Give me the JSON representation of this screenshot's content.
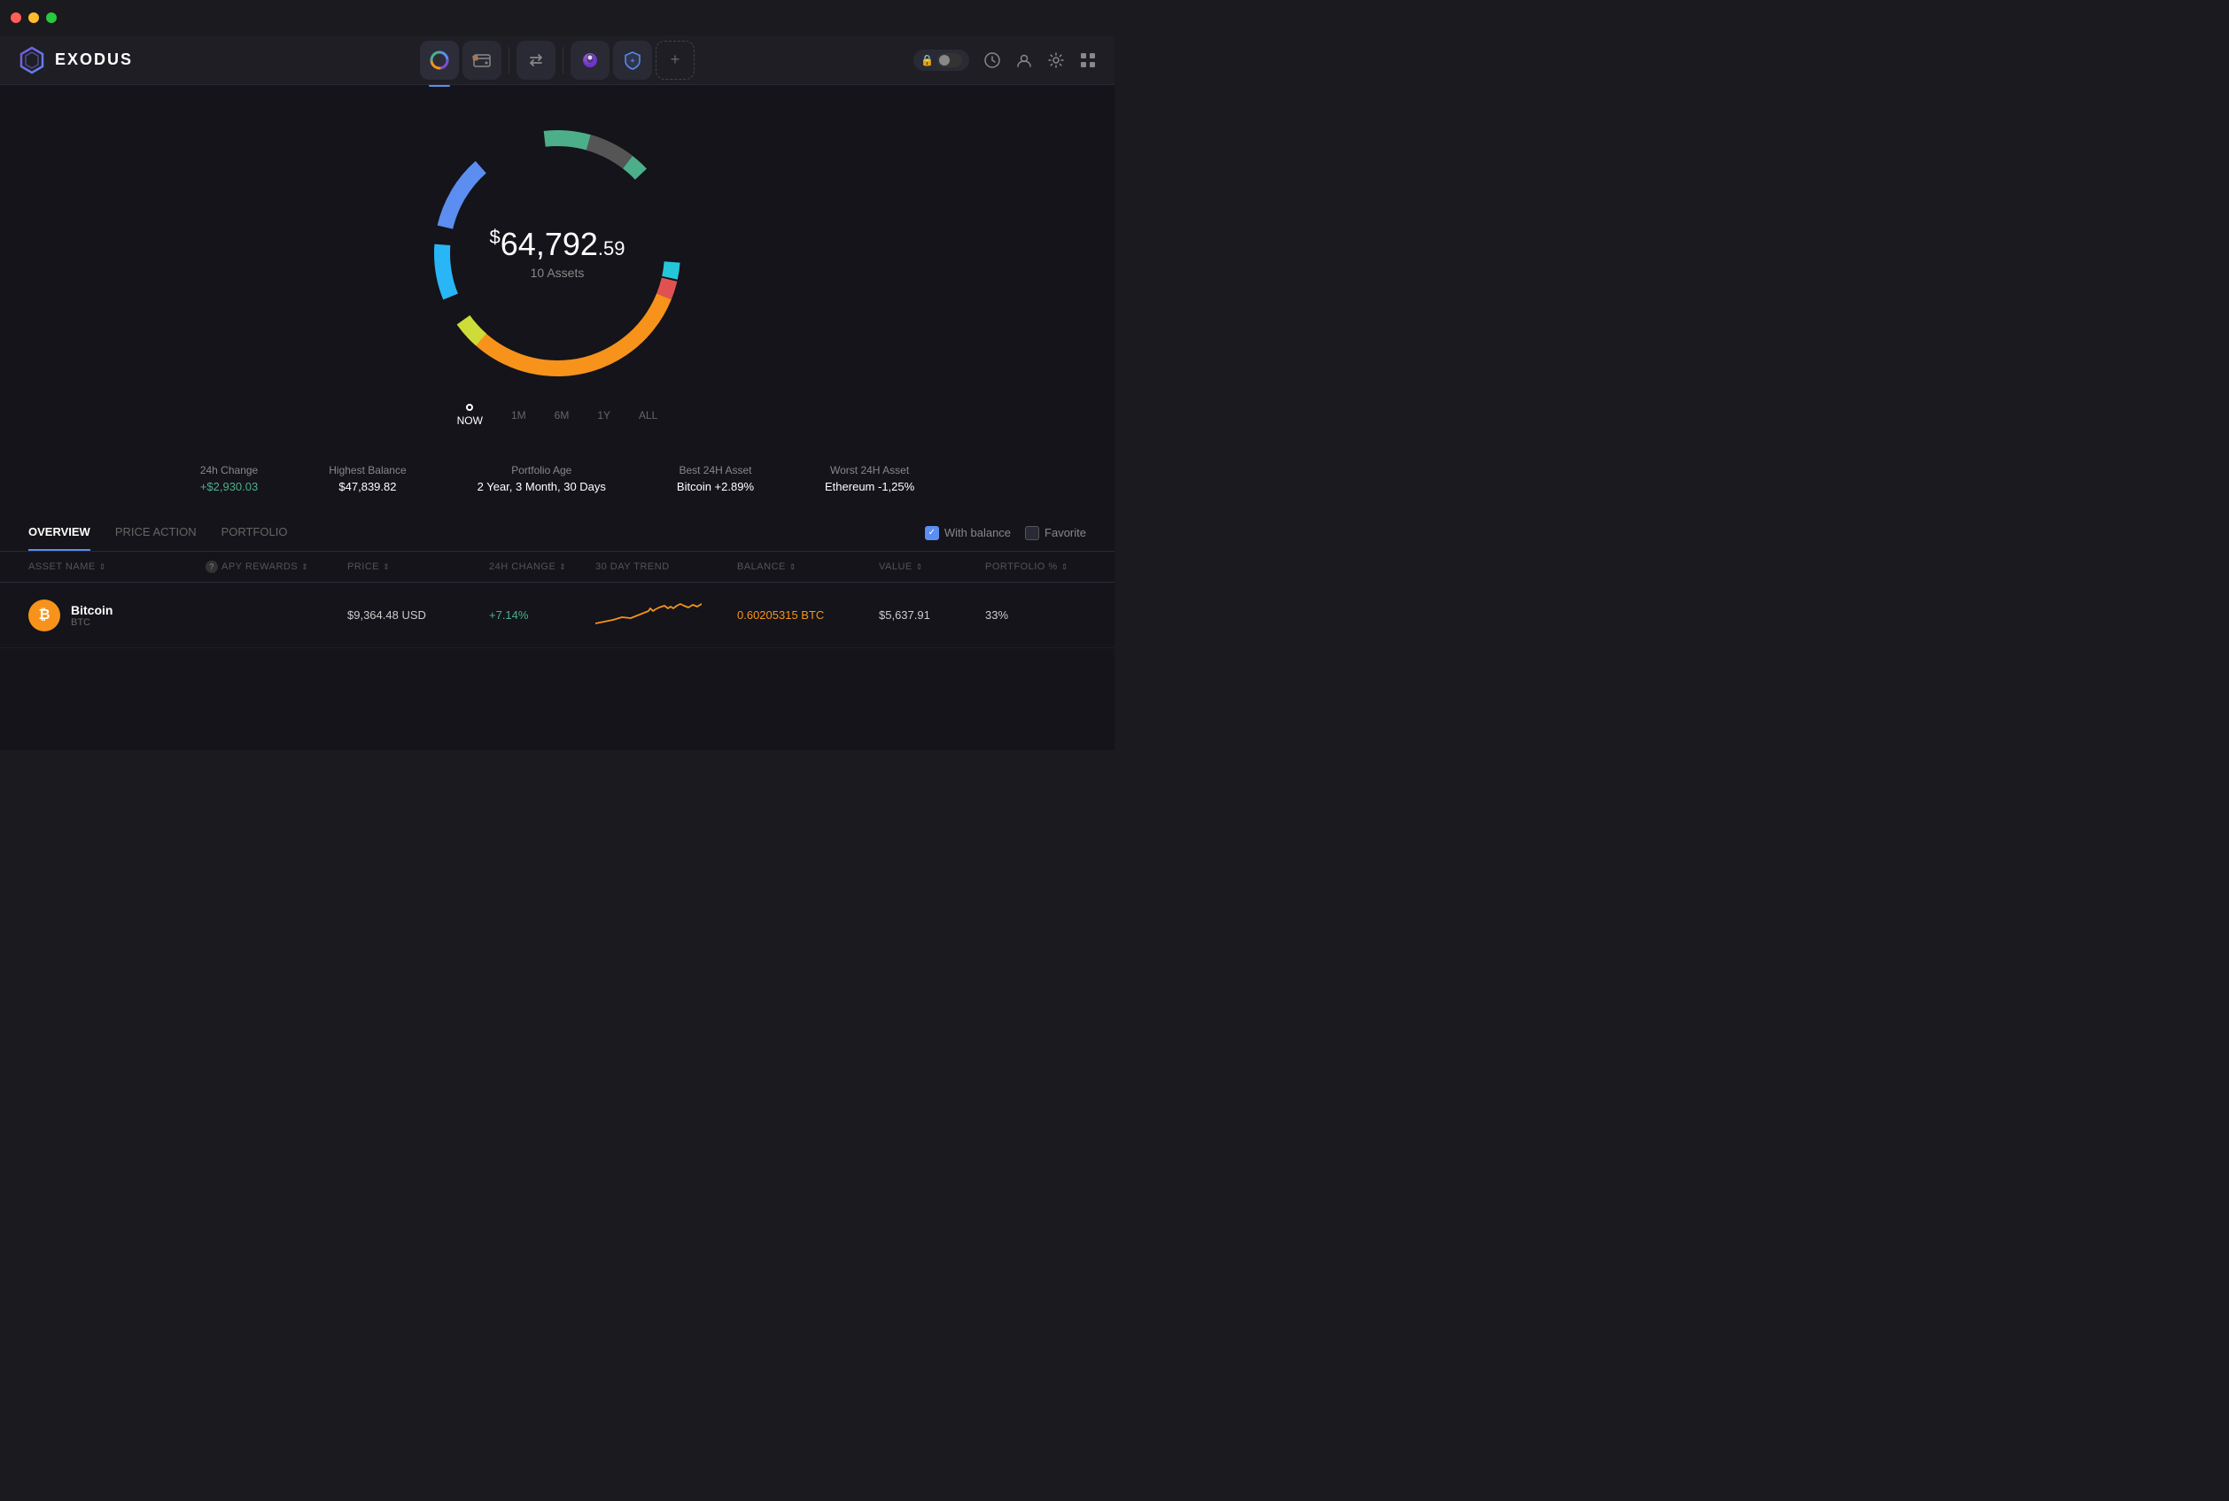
{
  "app": {
    "title": "EXODUS",
    "titlebar": {
      "dots": [
        "red",
        "yellow",
        "green"
      ]
    }
  },
  "nav": {
    "logo_icon": "⬡",
    "center_buttons": [
      {
        "id": "portfolio",
        "icon": "◕",
        "active": true,
        "label": "Portfolio"
      },
      {
        "id": "exchange",
        "icon": "wallet",
        "active": false,
        "label": "Wallet"
      },
      {
        "id": "swap",
        "icon": "⇄",
        "active": false,
        "label": "Swap"
      },
      {
        "id": "nft",
        "icon": "ghost",
        "active": false,
        "label": "NFT"
      },
      {
        "id": "earn",
        "icon": "shield+",
        "active": false,
        "label": "Earn"
      },
      {
        "id": "add",
        "icon": "+",
        "active": false,
        "label": "Add"
      }
    ],
    "right_buttons": [
      {
        "id": "lock",
        "icon": "🔒",
        "label": "Lock"
      },
      {
        "id": "history",
        "icon": "🕐",
        "label": "History"
      },
      {
        "id": "profile",
        "icon": "👤",
        "label": "Profile"
      },
      {
        "id": "settings",
        "icon": "⚙",
        "label": "Settings"
      },
      {
        "id": "grid",
        "icon": "⊞",
        "label": "Grid"
      }
    ]
  },
  "portfolio": {
    "total_amount": "64,792",
    "total_cents": ".59",
    "total_dollar_sign": "$",
    "assets_count": "10 Assets",
    "timeline": [
      {
        "label": "NOW",
        "active": true
      },
      {
        "label": "1M",
        "active": false
      },
      {
        "label": "6M",
        "active": false
      },
      {
        "label": "1Y",
        "active": false
      },
      {
        "label": "ALL",
        "active": false
      }
    ],
    "stats": [
      {
        "label": "24h Change",
        "value": "+$2,930.03",
        "positive": true
      },
      {
        "label": "Highest Balance",
        "value": "$47,839.82",
        "positive": false
      },
      {
        "label": "Portfolio Age",
        "value": "2 Year, 3 Month, 30 Days",
        "positive": false
      },
      {
        "label": "Best 24H Asset",
        "value": "Bitcoin +2.89%",
        "positive": false
      },
      {
        "label": "Worst 24H Asset",
        "value": "Ethereum -1,25%",
        "positive": false
      }
    ]
  },
  "tabs": [
    {
      "label": "OVERVIEW",
      "active": true
    },
    {
      "label": "PRICE ACTION",
      "active": false
    },
    {
      "label": "PORTFOLIO",
      "active": false
    }
  ],
  "filters": [
    {
      "label": "With balance",
      "checked": true
    },
    {
      "label": "Favorite",
      "checked": false
    }
  ],
  "table": {
    "columns": [
      {
        "key": "name",
        "label": "ASSET NAME",
        "sortable": true
      },
      {
        "key": "apy",
        "label": "APY REWARDS",
        "sortable": true,
        "help": true
      },
      {
        "key": "price",
        "label": "PRICE",
        "sortable": true
      },
      {
        "key": "change",
        "label": "24H CHANGE",
        "sortable": true
      },
      {
        "key": "trend",
        "label": "30 DAY TREND"
      },
      {
        "key": "balance",
        "label": "BALANCE",
        "sortable": true
      },
      {
        "key": "value",
        "label": "VALUE",
        "sortable": true
      },
      {
        "key": "portfolio",
        "label": "PORTFOLIO %",
        "sortable": true
      }
    ],
    "rows": [
      {
        "id": "bitcoin",
        "icon": "₿",
        "icon_bg": "#f7931a",
        "name": "Bitcoin",
        "ticker": "BTC",
        "apy": "",
        "price": "$9,364.48 USD",
        "change": "+7.14%",
        "change_positive": true,
        "balance": "0.60205315 BTC",
        "balance_color": "#f7931a",
        "value": "$5,637.91",
        "portfolio": "33%"
      }
    ]
  }
}
